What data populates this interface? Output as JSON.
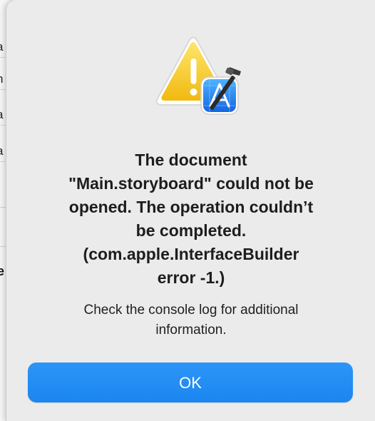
{
  "background_window": {
    "rows": [
      {
        "text": "a"
      },
      {
        "text": "h"
      },
      {
        "text": "a"
      },
      {
        "text": "a"
      }
    ],
    "bold_text": "e"
  },
  "alert": {
    "icon": "warning-triangle-with-xcode-icon",
    "title_lines": [
      "The document",
      "\"Main.storyboard\" could not be",
      "opened. The operation couldn’t",
      "be completed.",
      "(com.apple.InterfaceBuilder",
      "error -1.)"
    ],
    "message_lines": [
      "Check the console log for additional",
      "information."
    ],
    "ok_label": "OK"
  },
  "colors": {
    "accent": "#1e8cf5",
    "warning": "#f5c518",
    "sheet_background": "#ebebeb"
  }
}
